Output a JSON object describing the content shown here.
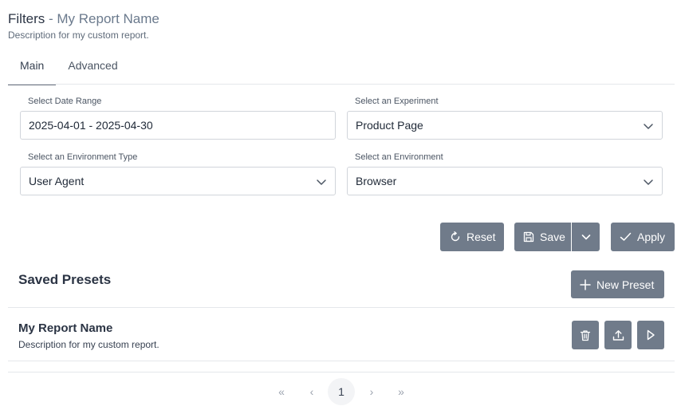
{
  "header": {
    "title": "Filters",
    "separator": " - ",
    "report_name": "My Report Name",
    "description": "Description for my custom report."
  },
  "tabs": [
    {
      "label": "Main",
      "active": true
    },
    {
      "label": "Advanced",
      "active": false
    }
  ],
  "filters": {
    "date_range": {
      "label": "Select Date Range",
      "value": "2025-04-01 - 2025-04-30"
    },
    "experiment": {
      "label": "Select an Experiment",
      "value": "Product Page"
    },
    "environment_type": {
      "label": "Select an Environment Type",
      "value": "User Agent"
    },
    "environment": {
      "label": "Select an Environment",
      "value": "Browser"
    }
  },
  "actions": {
    "reset": "Reset",
    "save": "Save",
    "apply": "Apply"
  },
  "presets": {
    "title": "Saved Presets",
    "new_label": "New Preset",
    "items": [
      {
        "name": "My Report Name",
        "description": "Description for my custom report."
      }
    ]
  },
  "pagination": {
    "first": "«",
    "prev": "‹",
    "current": "1",
    "next": "›",
    "last": "»"
  },
  "colors": {
    "button_bg": "#707b8a",
    "title": "#2b3444",
    "muted": "#6b7a8d"
  }
}
